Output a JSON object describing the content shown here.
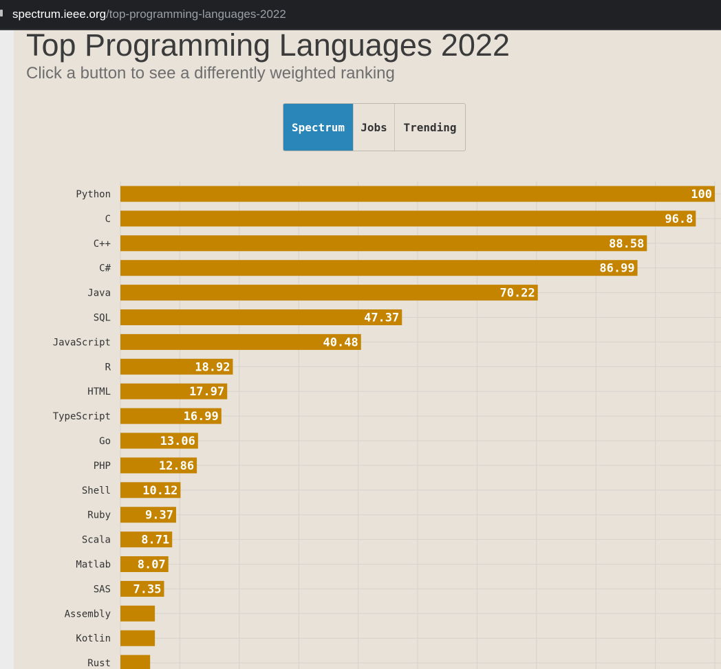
{
  "browser": {
    "url_host": "spectrum.ieee.org",
    "url_path": "/top-programming-languages-2022"
  },
  "page": {
    "title": "Top Programming Languages 2022",
    "subtitle": "Click a button to see a differently weighted ranking",
    "buttons": [
      {
        "label": "Spectrum",
        "active": true
      },
      {
        "label": "Jobs",
        "active": false
      },
      {
        "label": "Trending",
        "active": false
      }
    ]
  },
  "colors": {
    "bar": "#c48400",
    "grid": "#d6d2cc",
    "active_button": "#2a86b8"
  },
  "chart_data": {
    "type": "bar",
    "orientation": "horizontal",
    "xlim": [
      0,
      100
    ],
    "grid": true,
    "categories": [
      "Python",
      "C",
      "C++",
      "C#",
      "Java",
      "SQL",
      "JavaScript",
      "R",
      "HTML",
      "TypeScript",
      "Go",
      "PHP",
      "Shell",
      "Ruby",
      "Scala",
      "Matlab",
      "SAS",
      "Assembly",
      "Kotlin",
      "Rust"
    ],
    "values": [
      100,
      96.8,
      88.58,
      86.99,
      70.22,
      47.37,
      40.48,
      18.92,
      17.97,
      16.99,
      13.06,
      12.86,
      10.12,
      9.37,
      8.71,
      8.07,
      7.35,
      5.8,
      5.8,
      5.0
    ],
    "value_labels": [
      "100",
      "96.8",
      "88.58",
      "86.99",
      "70.22",
      "47.37",
      "40.48",
      "18.92",
      "17.97",
      "16.99",
      "13.06",
      "12.86",
      "10.12",
      "9.37",
      "8.71",
      "8.07",
      "7.35",
      "",
      "",
      ""
    ]
  }
}
